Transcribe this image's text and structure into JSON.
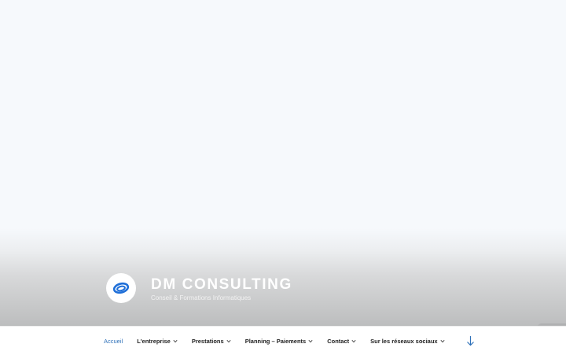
{
  "site": {
    "title": "DM CONSULTING",
    "description": "Conseil & Formations Informatiques",
    "logo_icon": "dm-logo-icon"
  },
  "nav": {
    "items": [
      {
        "label": "Accueil",
        "active": true,
        "has_submenu": false
      },
      {
        "label": "L'entreprise",
        "active": false,
        "has_submenu": true
      },
      {
        "label": "Prestations",
        "active": false,
        "has_submenu": true
      },
      {
        "label": "Planning – Paiements",
        "active": false,
        "has_submenu": true
      },
      {
        "label": "Contact",
        "active": false,
        "has_submenu": true
      },
      {
        "label": "Sur les réseaux sociaux",
        "active": false,
        "has_submenu": true
      }
    ],
    "scroll_icon": "arrow-down-icon"
  },
  "colors": {
    "accent": "#2f71b9",
    "logo_blue": "#1f6fd8",
    "menu_text": "#222222",
    "title_text": "#ffffff"
  }
}
